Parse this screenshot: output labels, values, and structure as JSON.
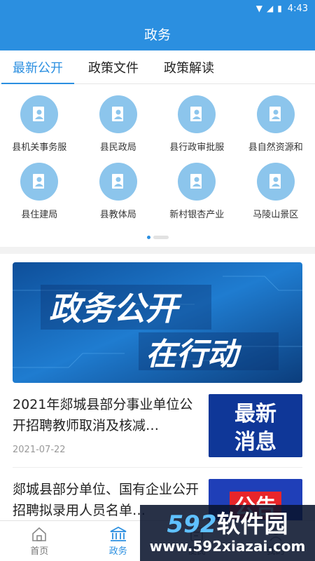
{
  "status": {
    "time": "4:43"
  },
  "header": {
    "title": "政务"
  },
  "tabs": [
    {
      "label": "最新公开"
    },
    {
      "label": "政策文件"
    },
    {
      "label": "政策解读"
    }
  ],
  "grid": [
    {
      "label": "县机关事务服"
    },
    {
      "label": "县民政局"
    },
    {
      "label": "县行政审批服"
    },
    {
      "label": "县自然资源和"
    },
    {
      "label": "县住建局"
    },
    {
      "label": "县教体局"
    },
    {
      "label": "新村银杏产业"
    },
    {
      "label": "马陵山景区"
    }
  ],
  "banner": {
    "line1": "政务公开",
    "line2": "在行动"
  },
  "news": [
    {
      "title": "2021年郯城县部分事业单位公开招聘教师取消及核减…",
      "date": "2021-07-22",
      "thumb": "最新\n消息"
    },
    {
      "title": "郯城县部分单位、国有企业公开招聘拟录用人员名单…",
      "date": "",
      "thumb": "公告"
    }
  ],
  "nav": [
    {
      "label": "首页",
      "icon": "home-icon"
    },
    {
      "label": "政务",
      "icon": "government-icon"
    },
    {
      "label": "便民",
      "icon": "service-icon"
    },
    {
      "label": "我的",
      "icon": "user-icon"
    }
  ],
  "watermark": {
    "num": "592",
    "cn": "软件园",
    "url": "www.592xiazai.com"
  },
  "colors": {
    "primary": "#2b8fe0",
    "icon_bg": "#8cc5ec"
  }
}
